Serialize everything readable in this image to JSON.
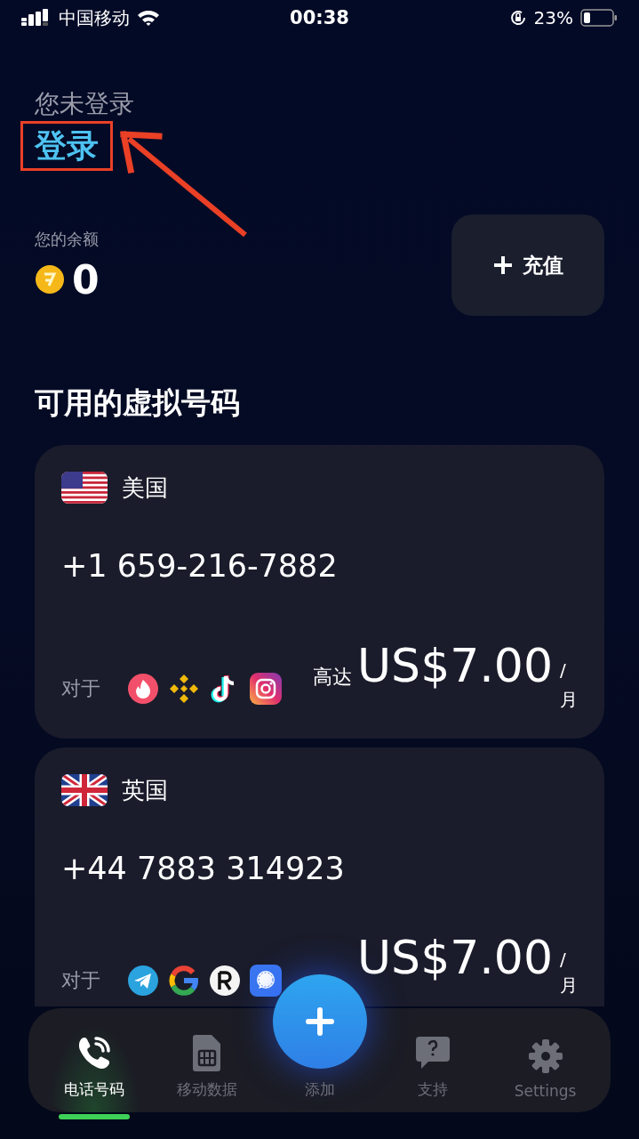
{
  "status_bar": {
    "carrier": "中国移动",
    "time": "00:38",
    "battery": "23%"
  },
  "account": {
    "status": "您未登录",
    "login": "登录"
  },
  "balance": {
    "label": "您的余额",
    "amount": "0",
    "topup": "充值"
  },
  "section_title": "可用的虚拟号码",
  "numbers": [
    {
      "country": "美国",
      "number": "+1 659-216-7882",
      "for_label": "对于",
      "apps": [
        {
          "kind": "flame"
        },
        {
          "kind": "diamond"
        },
        {
          "kind": "note"
        },
        {
          "kind": "camera"
        }
      ],
      "price_prefix": "高达",
      "price": "US$7.00",
      "per": "/",
      "unit": "月"
    },
    {
      "country": "英国",
      "number": "+44 7883 314923",
      "for_label": "对于",
      "apps": [
        {
          "kind": "plane"
        },
        {
          "kind": "ring"
        },
        {
          "kind": "disc"
        },
        {
          "kind": "bubble"
        }
      ],
      "price": "US$7.00",
      "per": "/",
      "unit": "月"
    }
  ],
  "tabs": [
    {
      "label": "电话号码",
      "selected": true
    },
    {
      "label": "移动数据",
      "selected": false
    },
    {
      "label": "添加",
      "selected": false
    },
    {
      "label": "支持",
      "selected": false
    },
    {
      "label": "Settings",
      "selected": false
    }
  ]
}
